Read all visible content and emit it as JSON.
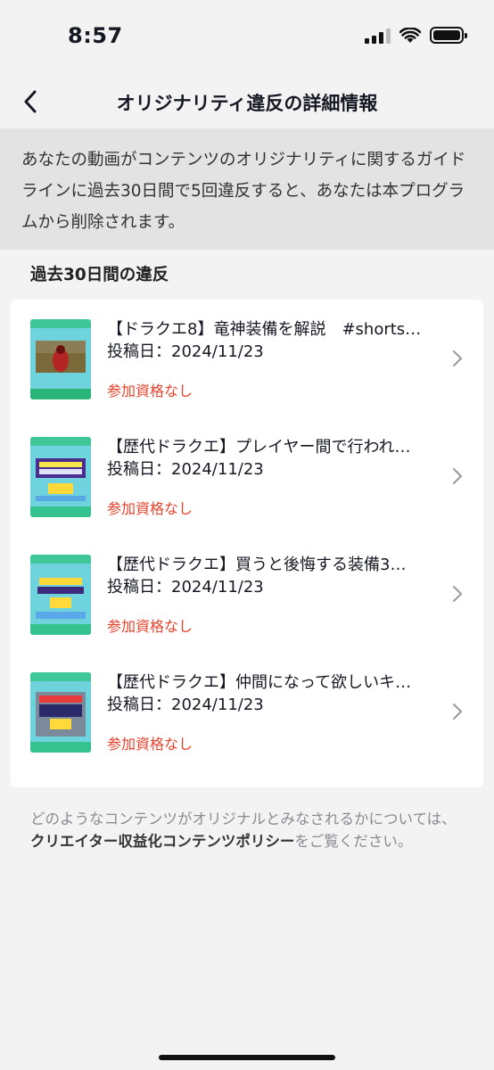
{
  "status_bar": {
    "time": "8:57"
  },
  "nav": {
    "title": "オリジナリティ違反の詳細情報"
  },
  "notice": {
    "text": "あなたの動画がコンテンツのオリジナリティに関するガイドラインに過去30日間で5回違反すると、あなたは本プログラムから削除されます。"
  },
  "section": {
    "title": "過去30日間の違反"
  },
  "violations": [
    {
      "title": "【ドラクエ8】竜神装備を解説　#shorts…",
      "date": "投稿日：2024/11/23",
      "status": "参加資格なし"
    },
    {
      "title": "【歴代ドラクエ】プレイヤー間で行われ…",
      "date": "投稿日：2024/11/23",
      "status": "参加資格なし"
    },
    {
      "title": "【歴代ドラクエ】買うと後悔する装備3…",
      "date": "投稿日：2024/11/23",
      "status": "参加資格なし"
    },
    {
      "title": "【歴代ドラクエ】仲間になって欲しいキ…",
      "date": "投稿日：2024/11/23",
      "status": "参加資格なし"
    }
  ],
  "footer": {
    "prefix": "どのようなコンテンツがオリジナルとみなされるかについては、",
    "link": "クリエイター収益化コンテンツポリシー",
    "suffix": "をご覧ください。"
  },
  "colors": {
    "accent_red": "#e8412c",
    "notice_bg": "#e3e3e3",
    "page_bg": "#f3f3f3"
  }
}
